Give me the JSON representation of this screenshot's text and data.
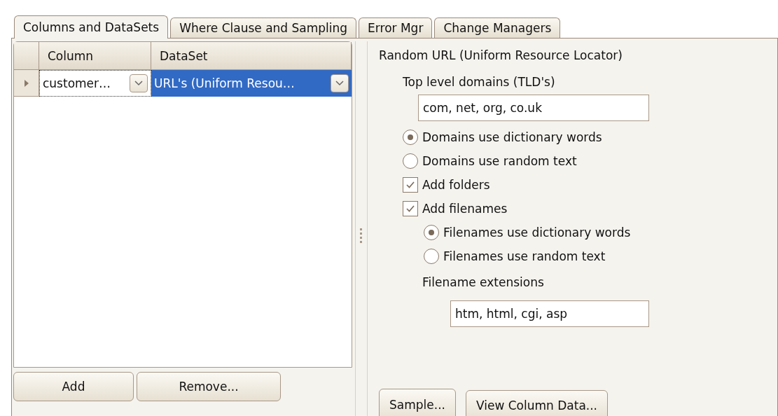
{
  "tabs": [
    {
      "label": "Columns and DataSets",
      "selected": true
    },
    {
      "label": "Where Clause and Sampling",
      "selected": false
    },
    {
      "label": "Error Mgr",
      "selected": false
    },
    {
      "label": "Change Managers",
      "selected": false
    }
  ],
  "grid": {
    "columns": [
      "Column",
      "DataSet"
    ],
    "rows": [
      {
        "current": true,
        "cells": [
          {
            "text": "customer…",
            "selected": false,
            "focused": true
          },
          {
            "text": "URL's (Uniform Resou…",
            "selected": true,
            "focused": false
          }
        ]
      }
    ]
  },
  "left_buttons": [
    "Add",
    "Remove..."
  ],
  "options": {
    "title": "Random URL (Uniform Resource Locator)",
    "tld_label": "Top level domains (TLD's)",
    "tld_value": "com, net, org, co.uk",
    "items": [
      {
        "kind": "radio",
        "label": "Domains use dictionary words",
        "checked": true,
        "nested": false
      },
      {
        "kind": "radio",
        "label": "Domains use random text",
        "checked": false,
        "nested": false
      },
      {
        "kind": "checkbox",
        "label": "Add folders",
        "checked": true,
        "nested": false
      },
      {
        "kind": "checkbox",
        "label": "Add filenames",
        "checked": true,
        "nested": false
      },
      {
        "kind": "radio",
        "label": "Filenames use dictionary words",
        "checked": true,
        "nested": true
      },
      {
        "kind": "radio",
        "label": "Filenames use random text",
        "checked": false,
        "nested": true
      }
    ],
    "ext_label": "Filename extensions",
    "ext_value": "htm, html, cgi, asp"
  },
  "right_buttons": [
    "Sample...",
    "View Column Data..."
  ]
}
